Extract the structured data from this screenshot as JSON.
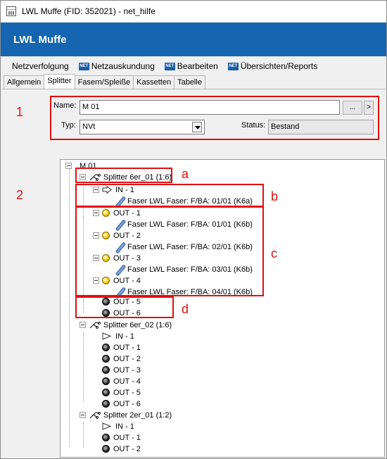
{
  "window": {
    "title": "LWL Muffe (FID: 352021) - net_hilfe"
  },
  "header": {
    "title": "LWL Muffe"
  },
  "menu": {
    "items": [
      {
        "label": "Netzverfolgung",
        "icon": ""
      },
      {
        "label": "Netzauskundung",
        "icon": "NET"
      },
      {
        "label": "Bearbeiten",
        "icon": "NET"
      },
      {
        "label": "Übersichten/Reports",
        "icon": "NET"
      }
    ]
  },
  "tabs": [
    "Allgemein",
    "Splitter",
    "Fasern/Spleiße",
    "Kassetten",
    "Tabelle"
  ],
  "active_tab": "Splitter",
  "form": {
    "name_label": "Name:",
    "name_value": "M 01",
    "browse_button": "...",
    "arrow_button": ">",
    "typ_label": "Typ:",
    "typ_value": "NVt",
    "status_label": "Status:",
    "status_value": "Bestand"
  },
  "annotations": {
    "box1": "1",
    "box2": "2",
    "a": "a",
    "b": "b",
    "c": "c",
    "d": "d"
  },
  "tree": {
    "root": "M 01",
    "splitter1": {
      "label": "Splitter 6er_01 (1:6)",
      "in": "IN - 1",
      "in_fiber": "Faser LWL Faser: F/BA: 01/01 (K6a)",
      "out1": "OUT - 1",
      "out1_fiber": "Faser LWL Faser: F/BA: 01/01 (K6b)",
      "out2": "OUT - 2",
      "out2_fiber": "Faser LWL Faser: F/BA: 02/01 (K6b)",
      "out3": "OUT - 3",
      "out3_fiber": "Faser LWL Faser: F/BA: 03/01 (K6b)",
      "out4": "OUT - 4",
      "out4_fiber": "Faser LWL Faser: F/BA: 04/01 (K6b)",
      "out5": "OUT - 5",
      "out6": "OUT - 6"
    },
    "splitter2": {
      "label": "Splitter 6er_02 (1:6)",
      "ports": [
        "IN - 1",
        "OUT - 1",
        "OUT - 2",
        "OUT - 3",
        "OUT - 4",
        "OUT - 5",
        "OUT - 6"
      ]
    },
    "splitter3": {
      "label": "Splitter 2er_01 (1:2)",
      "ports": [
        "IN - 1",
        "OUT - 1",
        "OUT - 2"
      ]
    }
  },
  "colors": {
    "header_blue": "#1565b0",
    "annotation_red": "#e01010",
    "port_yellow": "#f5c800",
    "port_black": "#111111"
  }
}
